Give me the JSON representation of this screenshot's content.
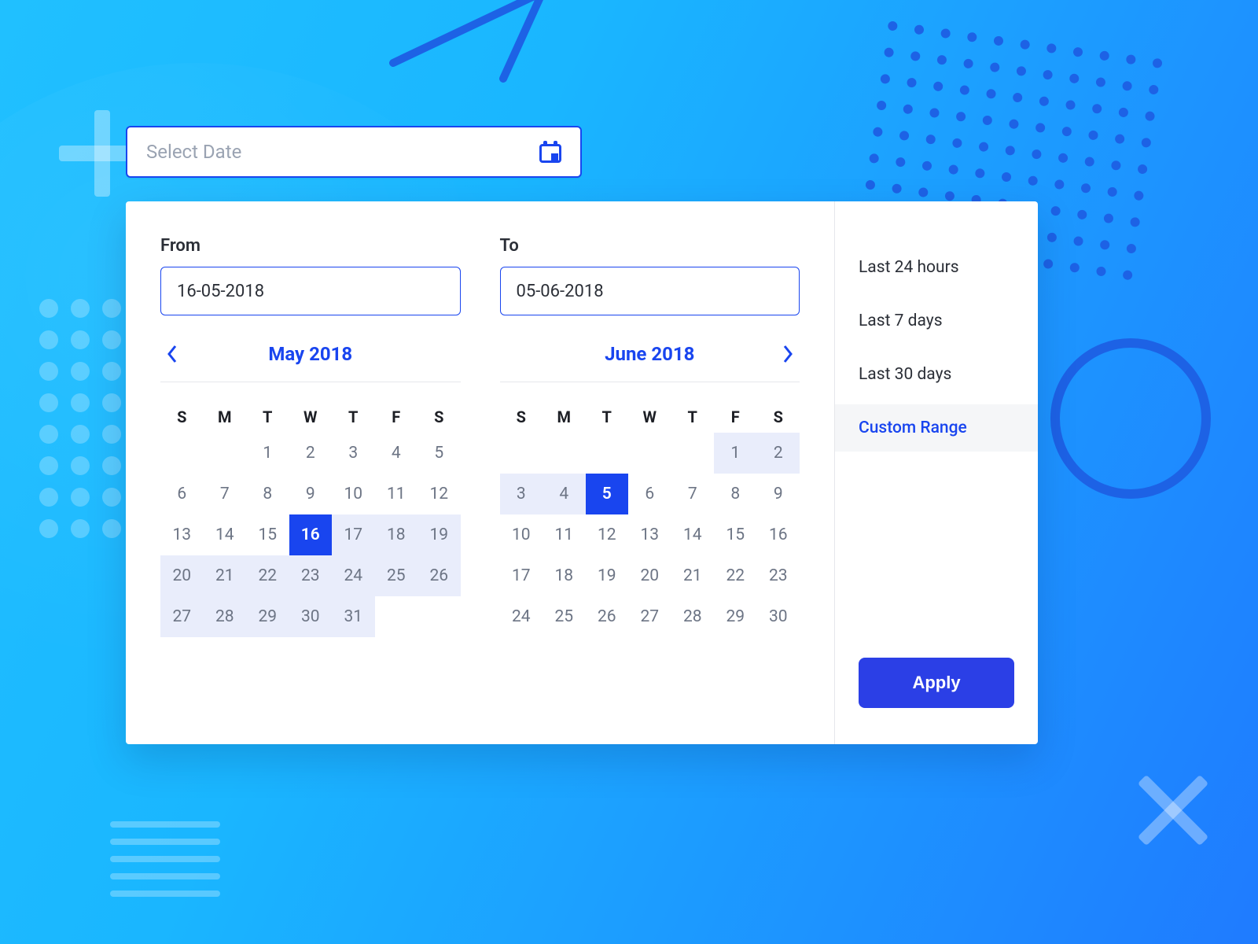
{
  "input": {
    "placeholder": "Select Date"
  },
  "labels": {
    "from": "From",
    "to": "To"
  },
  "values": {
    "from": "16-05-2018",
    "to": "05-06-2018"
  },
  "dow": [
    "S",
    "M",
    "T",
    "W",
    "T",
    "F",
    "S"
  ],
  "months": [
    {
      "title": "May 2018",
      "prev": true,
      "next": false,
      "leading_blanks": 2,
      "days": 31,
      "selected": 16,
      "range": [
        16,
        31
      ]
    },
    {
      "title": "June 2018",
      "prev": false,
      "next": true,
      "leading_blanks": 5,
      "days": 30,
      "selected": 5,
      "range": [
        1,
        5
      ]
    }
  ],
  "presets": [
    {
      "label": "Last 24 hours",
      "active": false
    },
    {
      "label": "Last 7 days",
      "active": false
    },
    {
      "label": "Last 30 days",
      "active": false
    },
    {
      "label": "Custom Range",
      "active": true
    }
  ],
  "apply_label": "Apply"
}
